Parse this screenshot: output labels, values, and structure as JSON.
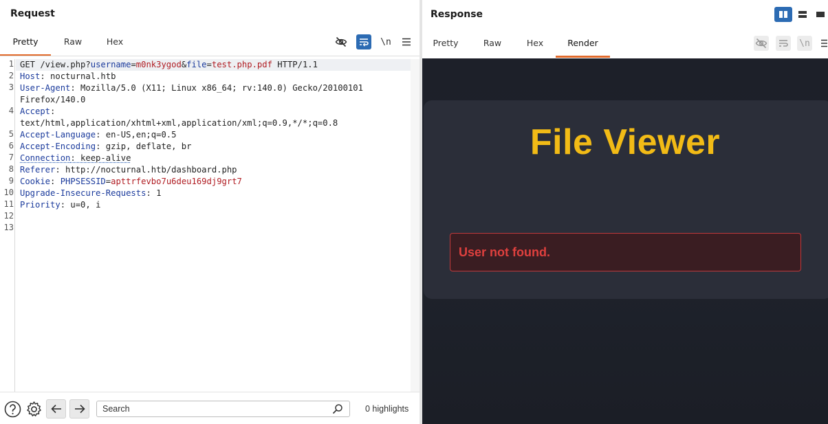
{
  "request": {
    "title": "Request",
    "tabs": [
      {
        "label": "Pretty",
        "active": true
      },
      {
        "label": "Raw",
        "active": false
      },
      {
        "label": "Hex",
        "active": false
      }
    ],
    "newline_toggle": "\\n",
    "line_numbers": [
      "1",
      "2",
      "3",
      "",
      "4",
      "",
      "5",
      "6",
      "7",
      "8",
      "9",
      "10",
      "11",
      "12",
      "13"
    ],
    "lines": {
      "l1": {
        "method_path": "GET /view.php?",
        "k1": "username",
        "eq1": "=",
        "v1": "m0nk3ygod",
        "amp": "&",
        "k2": "file",
        "eq2": "=",
        "v2": "test.php.pdf",
        "proto": " HTTP/1.1"
      },
      "l2": {
        "key": "Host",
        "value": ": nocturnal.htb"
      },
      "l3": {
        "key": "User-Agent",
        "value": ": Mozilla/5.0 (X11; Linux x86_64; rv:140.0) Gecko/20100101"
      },
      "l3b": {
        "value": "Firefox/140.0"
      },
      "l4": {
        "key": "Accept",
        "value": ":"
      },
      "l4b": {
        "value": "text/html,application/xhtml+xml,application/xml;q=0.9,*/*;q=0.8"
      },
      "l5": {
        "key": "Accept-Language",
        "value": ": en-US,en;q=0.5"
      },
      "l6": {
        "key": "Accept-Encoding",
        "value": ": gzip, deflate, br"
      },
      "l7": {
        "key": "Connection",
        "value": ": keep-alive"
      },
      "l8": {
        "key": "Referer",
        "value": ": http://nocturnal.htb/dashboard.php"
      },
      "l9": {
        "key": "Cookie",
        "value": ": ",
        "ckey": "PHPSESSID",
        "ceq": "=",
        "cval": "apttrfevbo7u6deu169dj9grt7"
      },
      "l10": {
        "key": "Upgrade-Insecure-Requests",
        "value": ": 1"
      },
      "l11": {
        "key": "Priority",
        "value": ": u=0, i"
      }
    },
    "search": {
      "placeholder": "Search",
      "highlights": "0 highlights"
    }
  },
  "response": {
    "title": "Response",
    "tabs": [
      {
        "label": "Pretty",
        "active": false
      },
      {
        "label": "Raw",
        "active": false
      },
      {
        "label": "Hex",
        "active": false
      },
      {
        "label": "Render",
        "active": true
      }
    ],
    "newline_toggle": "\\n",
    "render": {
      "heading": "File Viewer",
      "error": "User not found."
    }
  },
  "colors": {
    "accent_tab": "#e26b2c",
    "selected_tool": "#2c6bb3",
    "header_key": "#1a3a9c",
    "param_value": "#b01c22",
    "render_heading": "#f2bb16",
    "error_text": "#e0403e"
  }
}
